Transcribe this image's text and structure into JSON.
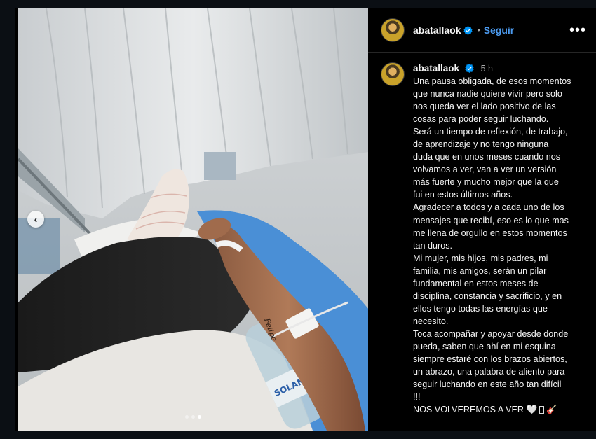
{
  "post": {
    "username": "abatallaok",
    "separator": "•",
    "follow_label": "Seguir",
    "more_label": "•••",
    "time_ago": "5 h",
    "caption": "Una pausa obligada, de esos momentos\nque nunca nadie quiere vivir pero solo\nnos queda ver el lado positivo de las\ncosas para poder seguir luchando.\nSerá un tiempo de reflexión, de trabajo,\nde aprendizaje y no tengo ninguna\nduda que en unos meses cuando nos\nvolvamos a ver, van a ver un versión\nmás fuerte y mucho mejor que la que\nfui en estos últimos años.\nAgradecer a todos y a cada uno de los\nmensajes que recibí, eso es lo que mas\nme llena de orgullo en estos momentos\ntan duros.\nMi mujer, mis hijos, mis padres, mi\nfamilia, mis amigos, serán un pilar\nfundamental en estos meses de\ndisciplina, constancia y sacrificio, y en\nellos tengo todas las energías que\nnecesito.\nToca acompañar y apoyar desde donde\npueda, saben que ahí en mi esquina\nsiempre estaré con los brazos abiertos,\nun abrazo, una palabra de aliento para\nseguir luchando en este año tan difícil\n!!!",
    "last_line": "NOS VOLVEREMOS A VER",
    "emojis": [
      "white-heart",
      "missing-glyph",
      "guitar"
    ]
  },
  "media": {
    "tattoo_text": "Felipe",
    "bottle_text": "SOLAN",
    "carousel": {
      "count": 3,
      "active_index": 2
    }
  },
  "colors": {
    "follow": "#4c9bf0",
    "verified": "#0095f6",
    "background": "#000000"
  }
}
